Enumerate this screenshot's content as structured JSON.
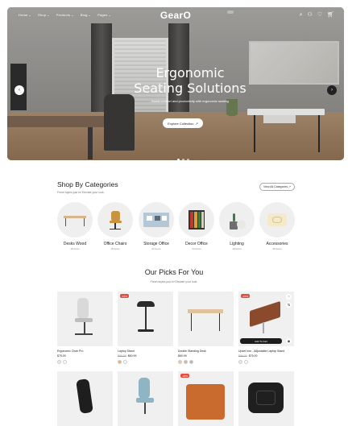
{
  "nav": {
    "items": [
      {
        "label": "Home"
      },
      {
        "label": "Shop"
      },
      {
        "label": "Products"
      },
      {
        "label": "Blog"
      },
      {
        "label": "Pages"
      }
    ],
    "logo": "GearO"
  },
  "hero": {
    "title_line1": "Ergonomic",
    "title_line2": "Seating Solutions",
    "subtitle": "Boost comfort and productivity with ergonomic seating",
    "button_label": "Explore Collection",
    "slides": 3,
    "active_slide": 1
  },
  "categories": {
    "title": "Shop By Categories",
    "subtitle": "Fresh styles just in! Elevate your look.",
    "view_all": "View All Categories",
    "items": [
      {
        "name": "Desks Wood",
        "count": "15 Items"
      },
      {
        "name": "Office Chairs",
        "count": "15 Items"
      },
      {
        "name": "Storage Office",
        "count": "22 Items"
      },
      {
        "name": "Decor Office",
        "count": "24 Items"
      },
      {
        "name": "Lighting",
        "count": "18 Items"
      },
      {
        "name": "Accessories",
        "count": "30 Items"
      }
    ]
  },
  "picks": {
    "title": "Our Picks For You",
    "subtitle": "Fresh styles just in! Elevate your look.",
    "products": [
      {
        "name": "Ergonomic Chair Pro",
        "price": "$75.00",
        "old_price": "",
        "badge": "",
        "swatches": [
          "#e9e9e9",
          "#ffffff"
        ]
      },
      {
        "name": "Laptop Stand",
        "price": "$60.99",
        "old_price": "$90.00",
        "badge": "-15%",
        "swatches": [
          "#e8b07a",
          "#ffffff"
        ]
      },
      {
        "name": "Double Standing Desk",
        "price": "$60.99",
        "old_price": "",
        "badge": "",
        "swatches": [
          "#e4c7ad",
          "#d7b2a3",
          "#b5b5b5"
        ]
      },
      {
        "name": "Upset Iron - Adjustable Laptop Stand",
        "price": "$75.00",
        "old_price": "$90.00",
        "badge": "-15%",
        "swatches": [
          "#e9e9e9",
          "#ffffff"
        ],
        "add_to_cart": "Add To Cart"
      },
      {
        "name": "",
        "price": "",
        "old_price": "",
        "badge": "",
        "swatches": []
      },
      {
        "name": "",
        "price": "",
        "old_price": "",
        "badge": "",
        "swatches": []
      },
      {
        "name": "",
        "price": "",
        "old_price": "",
        "badge": "-20%",
        "swatches": []
      },
      {
        "name": "",
        "price": "",
        "old_price": "",
        "badge": "",
        "swatches": []
      }
    ]
  },
  "icons": {
    "search": "search-icon",
    "account": "user-icon",
    "wishlist": "heart-icon",
    "cart": "cart-icon"
  }
}
